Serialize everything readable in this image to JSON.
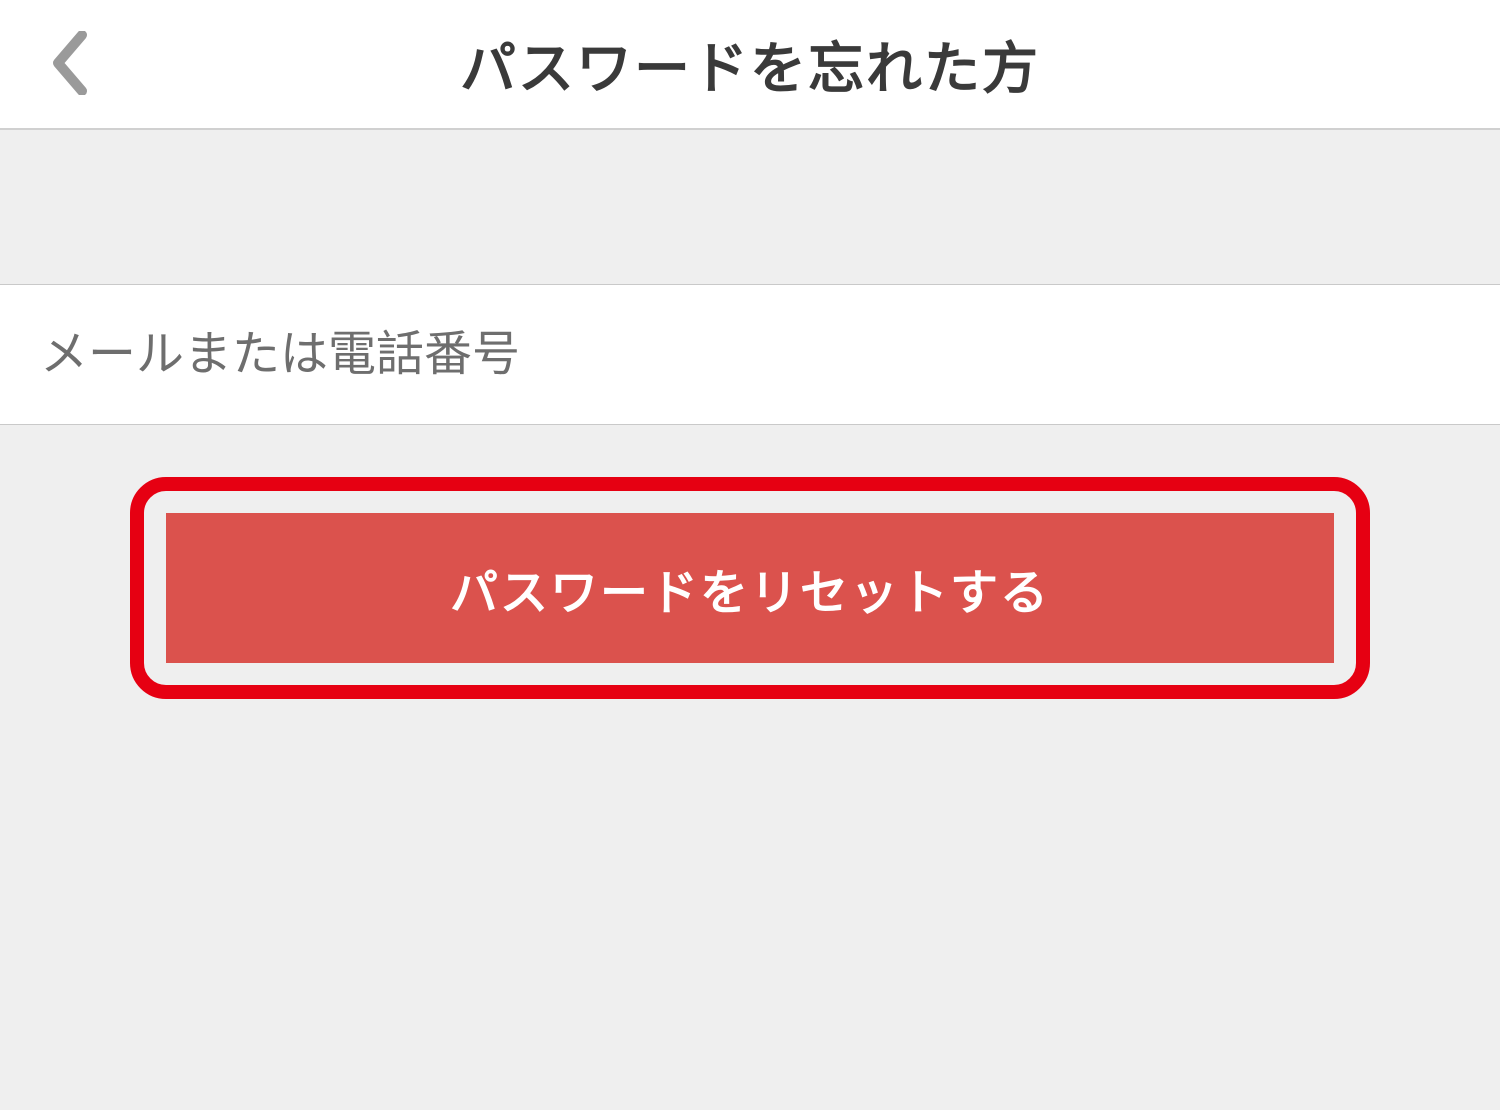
{
  "header": {
    "title": "パスワードを忘れた方"
  },
  "form": {
    "email_or_phone_placeholder": "メールまたは電話番号",
    "email_or_phone_value": ""
  },
  "actions": {
    "reset_label": "パスワードをリセットする"
  }
}
